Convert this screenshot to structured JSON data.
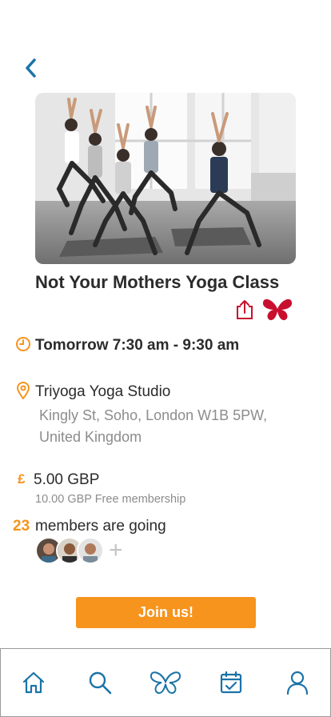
{
  "colors": {
    "accent": "#f7941d",
    "primary": "#1a73a8",
    "favorite": "#c8102e"
  },
  "event": {
    "title": "Not Your Mothers Yoga Class",
    "time": "Tomorrow 7:30 am - 9:30 am",
    "venue": "Triyoga Yoga Studio",
    "address": "Kingly St, Soho, London W1B 5PW, United Kingdom",
    "currency_symbol": "£",
    "price": "5.00 GBP",
    "membership_note": "10.00 GBP Free membership",
    "going_count": "23",
    "going_label": "members are going"
  },
  "actions": {
    "join_label": "Join us!"
  },
  "icons": {
    "back": "chevron-left-icon",
    "share": "share-icon",
    "favorite": "butterfly-icon",
    "time": "clock-icon",
    "location": "map-pin-icon",
    "add": "plus-icon"
  },
  "tabbar": [
    {
      "name": "home",
      "icon": "home-icon"
    },
    {
      "name": "search",
      "icon": "search-icon"
    },
    {
      "name": "community",
      "icon": "butterfly-icon"
    },
    {
      "name": "calendar",
      "icon": "calendar-check-icon"
    },
    {
      "name": "profile",
      "icon": "user-icon"
    }
  ]
}
